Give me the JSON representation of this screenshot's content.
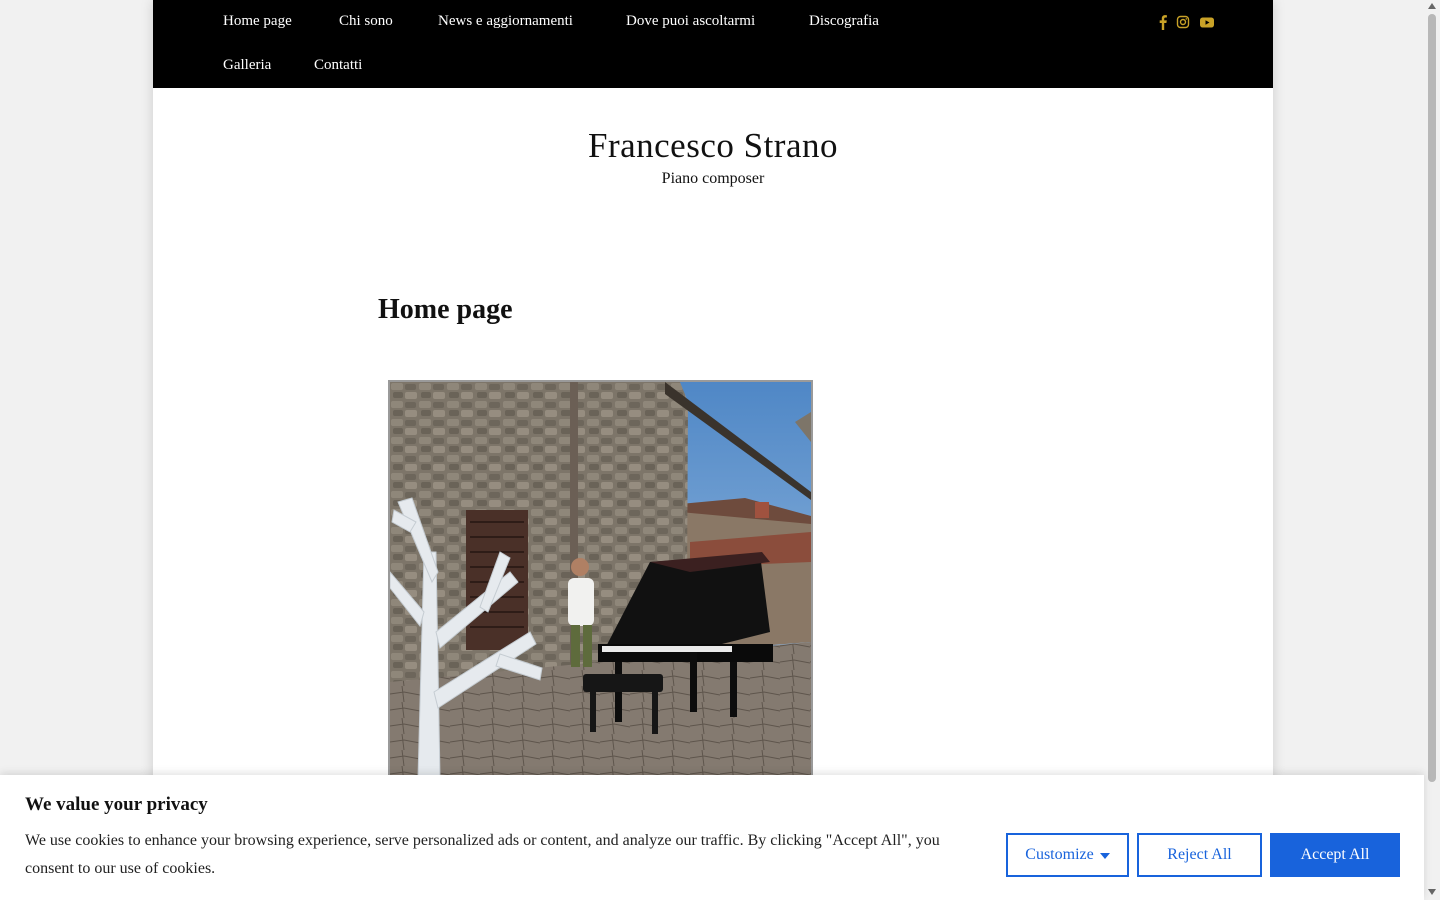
{
  "nav": {
    "row1": [
      "Home page",
      "Chi sono",
      "News e aggiornamenti",
      "Dove puoi ascoltarmi",
      "Discografia"
    ],
    "row2": [
      "Galleria",
      "Contatti"
    ],
    "social_icons": [
      "facebook-icon",
      "instagram-icon",
      "youtube-icon"
    ],
    "social_color": "#c9a227"
  },
  "site": {
    "title": "Francesco Strano",
    "tagline": "Piano composer"
  },
  "main": {
    "heading": "Home page"
  },
  "cookie": {
    "title": "We value your privacy",
    "text": "We use cookies to enhance your browsing experience, serve personalized ads or content, and analyze our traffic. By clicking \"Accept All\", you consent to our use of cookies.",
    "customize_label": "Customize",
    "reject_label": "Reject All",
    "accept_label": "Accept All",
    "accent_color": "#1863dc"
  }
}
